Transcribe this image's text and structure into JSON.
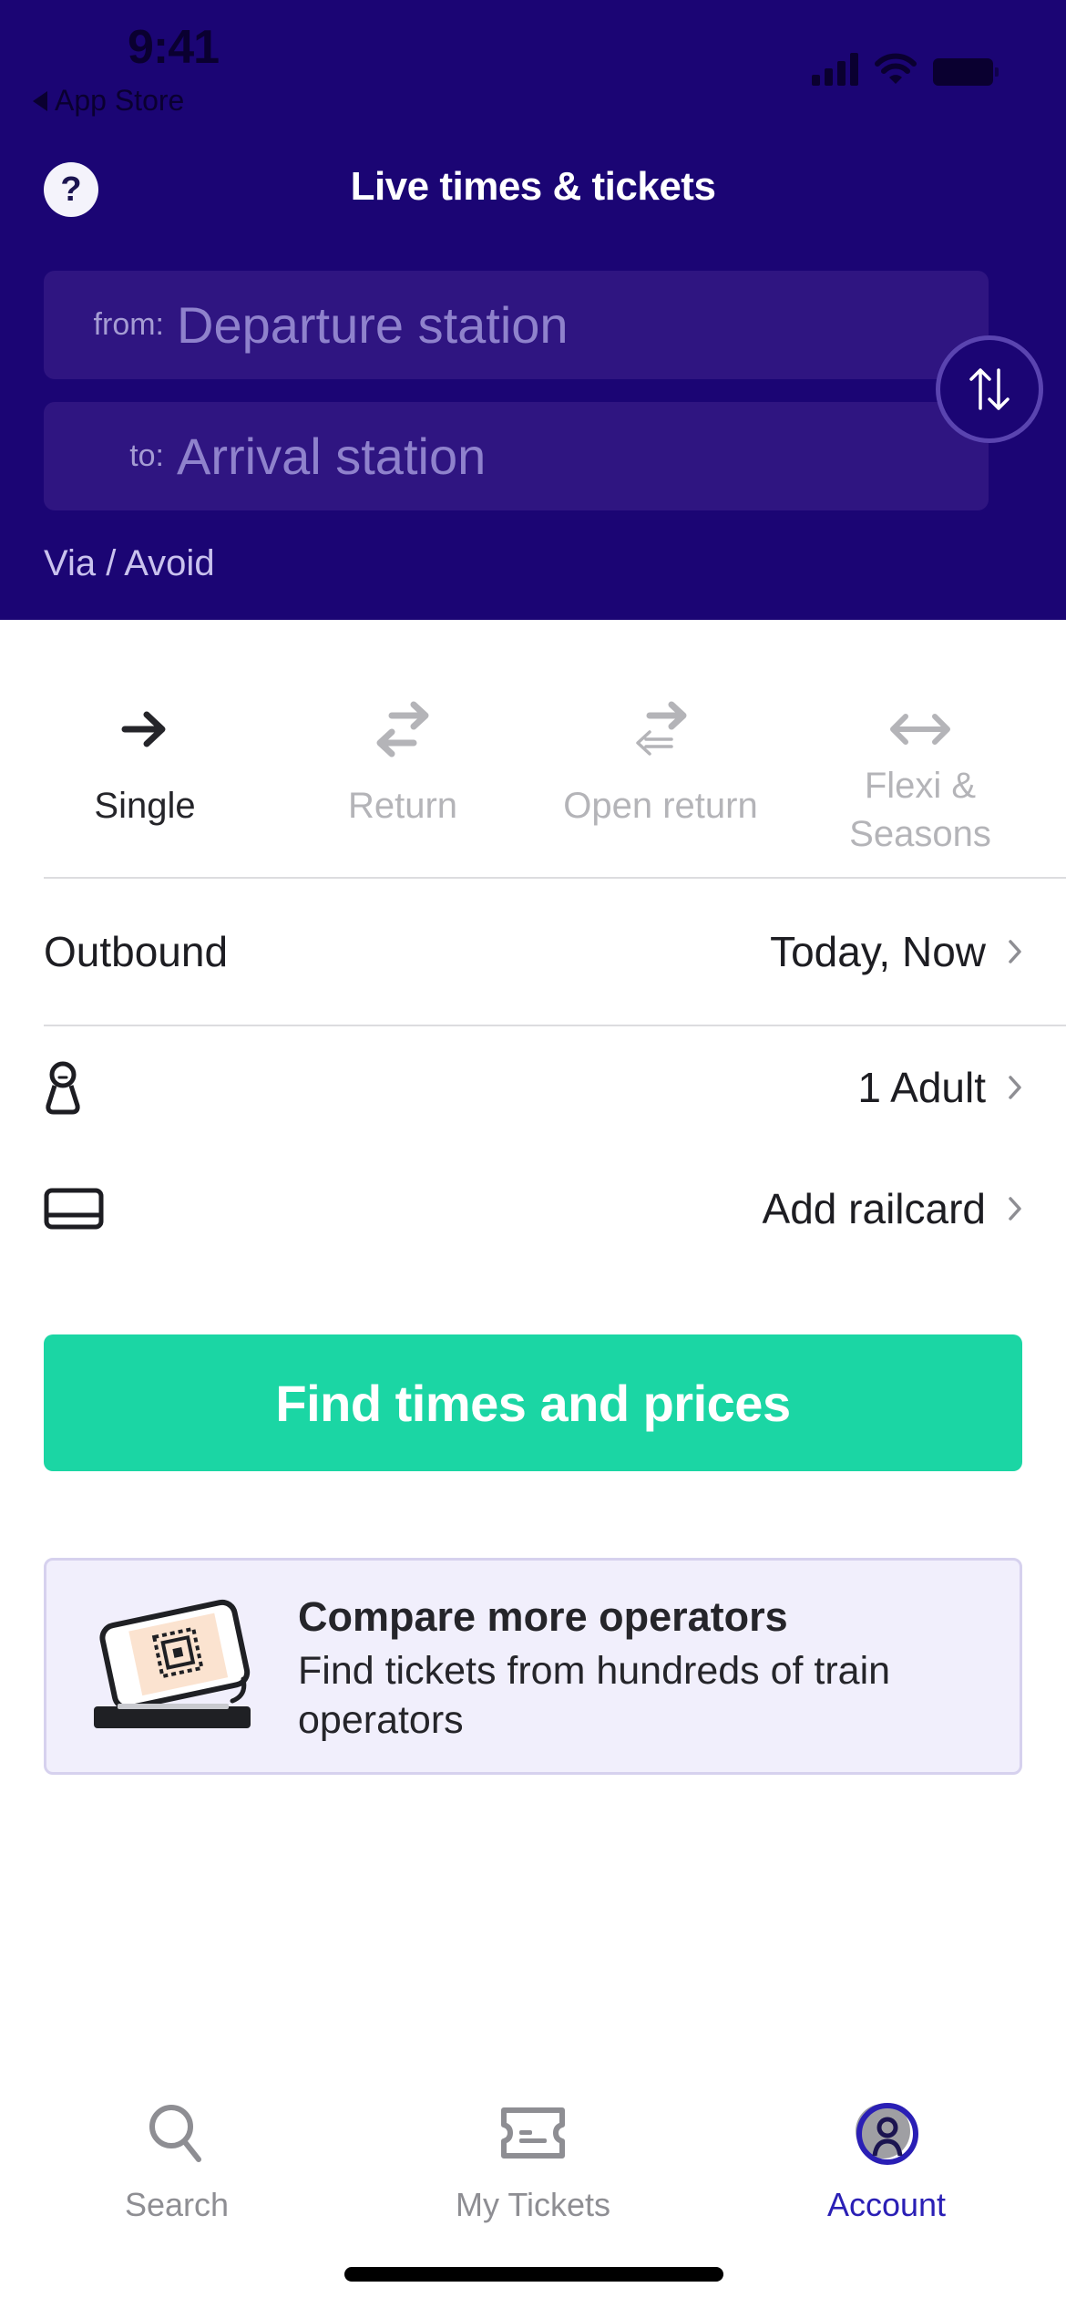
{
  "status_bar": {
    "time": "9:41",
    "back_app": "App Store",
    "icons": [
      "cellular-signal-icon",
      "wifi-icon",
      "battery-icon"
    ]
  },
  "header": {
    "help_icon": "question-mark-icon",
    "help_label": "?",
    "title": "Live times & tickets",
    "from_label": "from:",
    "from_placeholder": "Departure station",
    "to_label": "to:",
    "to_placeholder": "Arrival station",
    "swap_icon": "swap-vertical-arrows-icon",
    "via_avoid": "Via / Avoid"
  },
  "trip_types": [
    {
      "label": "Single",
      "icon": "arrow-right-icon",
      "active": true
    },
    {
      "label": "Return",
      "icon": "return-arrows-icon",
      "active": false
    },
    {
      "label": "Open return",
      "icon": "open-return-arrows-icon",
      "active": false
    },
    {
      "label": "Flexi & Seasons",
      "label_line1": "Flexi &",
      "label_line2": "Seasons",
      "icon": "double-arrow-icon",
      "active": false
    }
  ],
  "journey": {
    "outbound_label": "Outbound",
    "outbound_value": "Today, Now",
    "passengers_icon": "person-icon",
    "passengers_value": "1 Adult",
    "railcard_icon": "railcard-icon",
    "railcard_value": "Add railcard"
  },
  "cta": {
    "label": "Find times and prices",
    "color": "#1bd6a4"
  },
  "promo": {
    "illustration": "ticket-scanner-illustration",
    "title": "Compare more operators",
    "body": "Find tickets from hundreds of train operators"
  },
  "tabbar": {
    "items": [
      {
        "label": "Search",
        "icon": "search-icon",
        "active": false
      },
      {
        "label": "My Tickets",
        "icon": "ticket-icon",
        "active": false
      },
      {
        "label": "Account",
        "icon": "account-icon",
        "active": true
      }
    ]
  },
  "colors": {
    "header_bg": "#1b0574",
    "field_bg": "#2f1581",
    "accent_green": "#1bd6a4",
    "active_tab": "#2a1fb5",
    "inactive": "#8e8e93"
  }
}
